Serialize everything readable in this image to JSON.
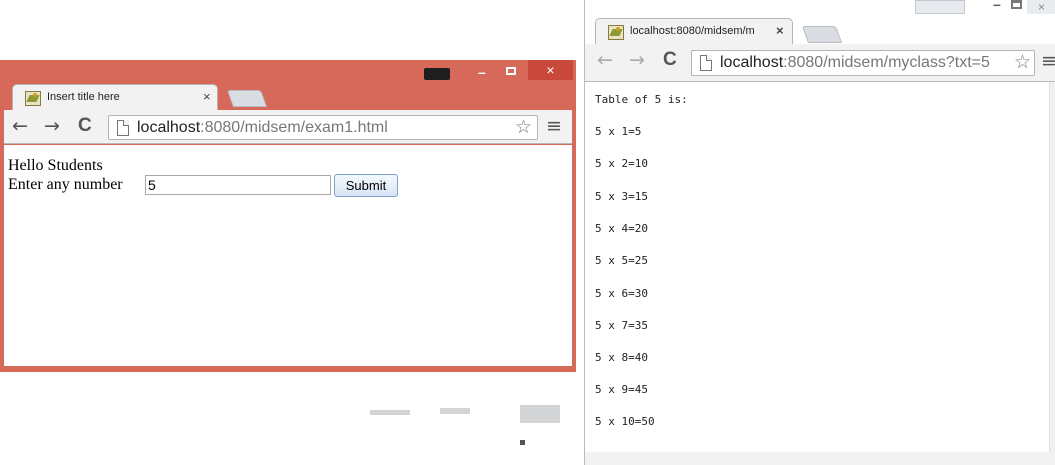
{
  "left_window": {
    "tab_title": "Insert title here",
    "tab_close": "×",
    "url_host": "localhost",
    "url_rest": ":8080/midsem/exam1.html",
    "nav_back": "←",
    "nav_forward": "→",
    "nav_reload": "C",
    "star": "☆",
    "menu": "≡",
    "close_glyph": "×",
    "min_glyph": "–",
    "content": {
      "greeting": "Hello Students",
      "prompt": "Enter any number",
      "input_value": "5",
      "submit_label": "Submit"
    }
  },
  "right_window": {
    "tab_title": "localhost:8080/midsem/m",
    "tab_close": "×",
    "url_host": "localhost",
    "url_rest": ":8080/midsem/myclass?txt=5",
    "nav_back": "←",
    "nav_forward": "→",
    "nav_reload": "C",
    "star": "☆",
    "menu": "≡",
    "close_glyph": "×",
    "min_glyph": "–",
    "content": {
      "heading": "Table of 5 is:",
      "rows": [
        "5 x 1=5",
        "5 x 2=10",
        "5 x 3=15",
        "5 x 4=20",
        "5 x 5=25",
        "5 x 6=30",
        "5 x 7=35",
        "5 x 8=40",
        "5 x 9=45",
        "5 x 10=50"
      ]
    }
  },
  "colors": {
    "left_frame": "#d6695a",
    "close_button": "#c9483c",
    "toolbar_bg": "#f2f2f2"
  }
}
